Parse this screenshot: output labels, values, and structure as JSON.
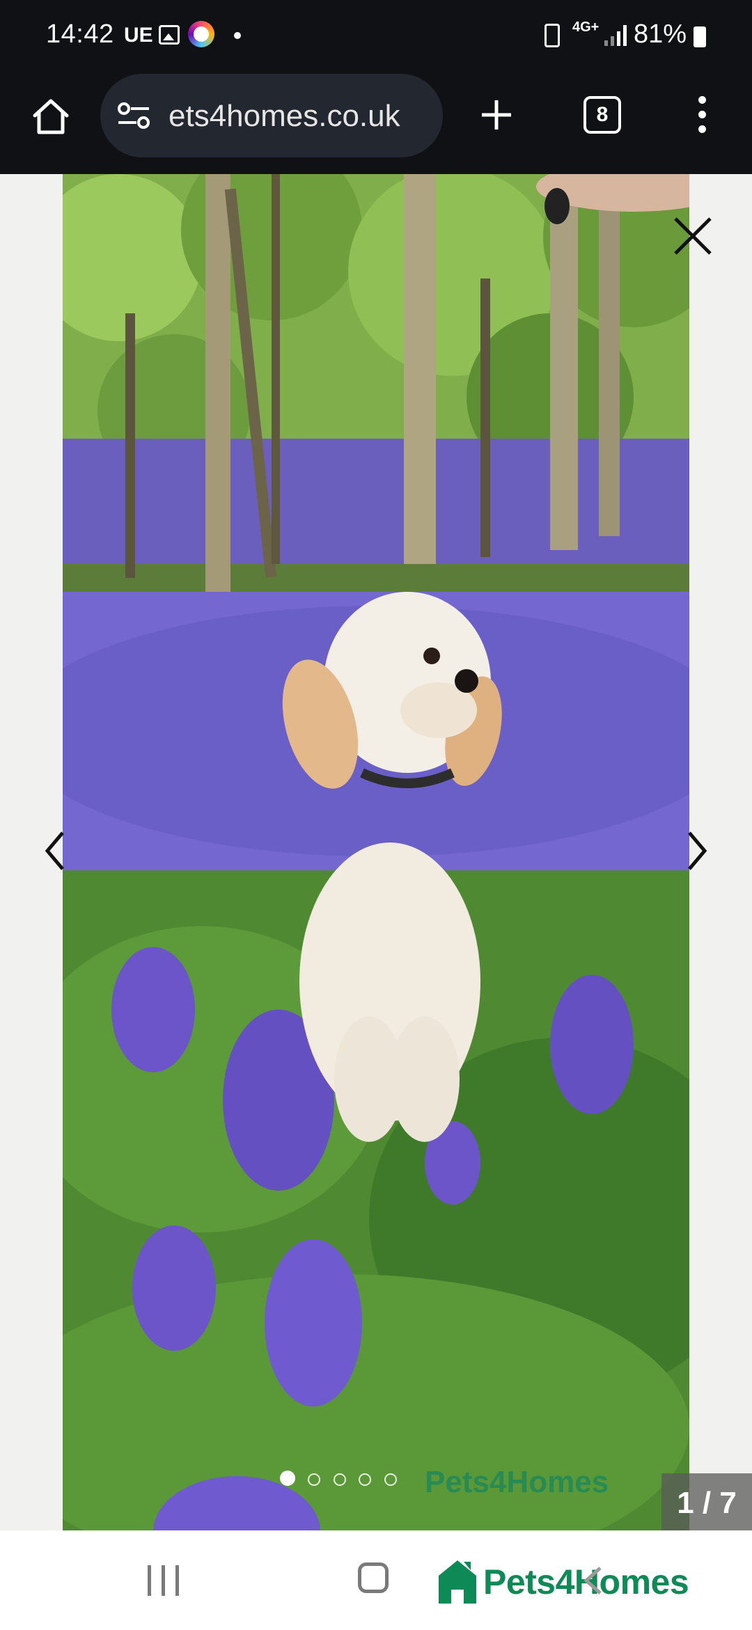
{
  "status_bar": {
    "time": "14:42",
    "carrier": "UE",
    "network": "4G+",
    "battery": "81%"
  },
  "browser": {
    "url": "ets4homes.co.uk",
    "tab_count": "8"
  },
  "viewer": {
    "counter": "1 / 7",
    "watermark": "Pets4Homes",
    "total_images": 7,
    "current_index": 1
  },
  "footer": {
    "brand": "Pets4Homes"
  },
  "colors": {
    "brand_green": "#0d8a56",
    "status_bg": "#0f1115"
  }
}
